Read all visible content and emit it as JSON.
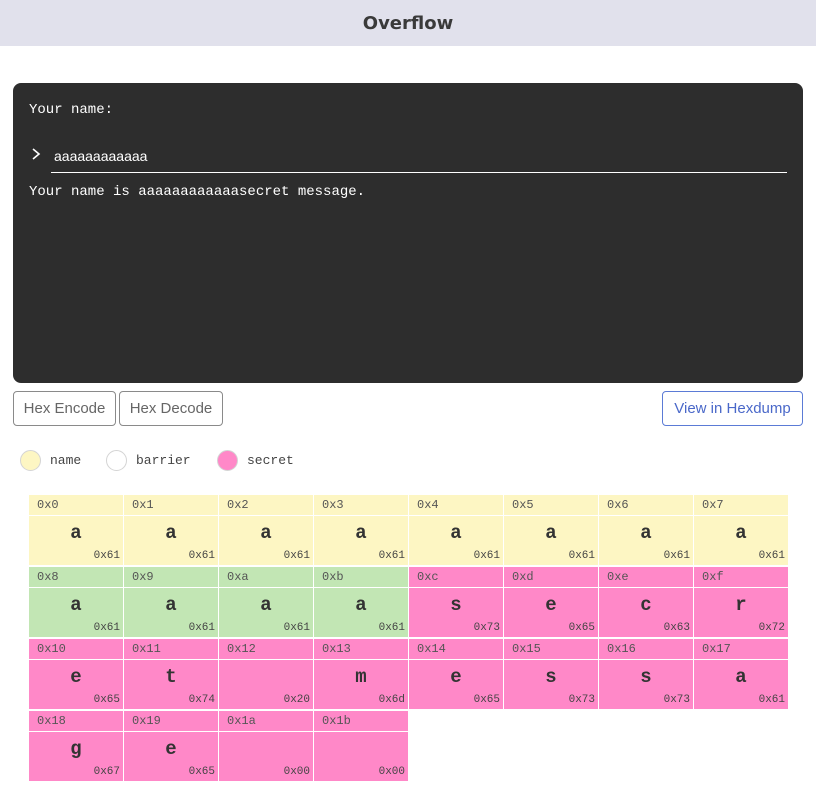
{
  "header": {
    "title": "Overflow"
  },
  "terminal": {
    "prompt": "Your name:",
    "input_value": "aaaaaaaaaaaa",
    "output": "Your name is aaaaaaaaaaaasecret message."
  },
  "buttons": {
    "hex_encode": "Hex Encode",
    "hex_decode": "Hex Decode",
    "view_hexdump": "View in Hexdump"
  },
  "legend": [
    {
      "label": "name",
      "color": "#fdf6c3"
    },
    {
      "label": "barrier",
      "color": "#ffffff"
    },
    {
      "label": "secret",
      "color": "#ff88c8"
    }
  ],
  "region_colors": {
    "name": "#fdf6c3",
    "barrier": "#c2e6b4",
    "secret": "#ff88c8"
  },
  "memory": [
    {
      "addr": "0x0",
      "char": "a",
      "hex": "0x61",
      "region": "name"
    },
    {
      "addr": "0x1",
      "char": "a",
      "hex": "0x61",
      "region": "name"
    },
    {
      "addr": "0x2",
      "char": "a",
      "hex": "0x61",
      "region": "name"
    },
    {
      "addr": "0x3",
      "char": "a",
      "hex": "0x61",
      "region": "name"
    },
    {
      "addr": "0x4",
      "char": "a",
      "hex": "0x61",
      "region": "name"
    },
    {
      "addr": "0x5",
      "char": "a",
      "hex": "0x61",
      "region": "name"
    },
    {
      "addr": "0x6",
      "char": "a",
      "hex": "0x61",
      "region": "name"
    },
    {
      "addr": "0x7",
      "char": "a",
      "hex": "0x61",
      "region": "name"
    },
    {
      "addr": "0x8",
      "char": "a",
      "hex": "0x61",
      "region": "barrier"
    },
    {
      "addr": "0x9",
      "char": "a",
      "hex": "0x61",
      "region": "barrier"
    },
    {
      "addr": "0xa",
      "char": "a",
      "hex": "0x61",
      "region": "barrier"
    },
    {
      "addr": "0xb",
      "char": "a",
      "hex": "0x61",
      "region": "barrier"
    },
    {
      "addr": "0xc",
      "char": "s",
      "hex": "0x73",
      "region": "secret"
    },
    {
      "addr": "0xd",
      "char": "e",
      "hex": "0x65",
      "region": "secret"
    },
    {
      "addr": "0xe",
      "char": "c",
      "hex": "0x63",
      "region": "secret"
    },
    {
      "addr": "0xf",
      "char": "r",
      "hex": "0x72",
      "region": "secret"
    },
    {
      "addr": "0x10",
      "char": "e",
      "hex": "0x65",
      "region": "secret"
    },
    {
      "addr": "0x11",
      "char": "t",
      "hex": "0x74",
      "region": "secret"
    },
    {
      "addr": "0x12",
      "char": "",
      "hex": "0x20",
      "region": "secret"
    },
    {
      "addr": "0x13",
      "char": "m",
      "hex": "0x6d",
      "region": "secret"
    },
    {
      "addr": "0x14",
      "char": "e",
      "hex": "0x65",
      "region": "secret"
    },
    {
      "addr": "0x15",
      "char": "s",
      "hex": "0x73",
      "region": "secret"
    },
    {
      "addr": "0x16",
      "char": "s",
      "hex": "0x73",
      "region": "secret"
    },
    {
      "addr": "0x17",
      "char": "a",
      "hex": "0x61",
      "region": "secret"
    },
    {
      "addr": "0x18",
      "char": "g",
      "hex": "0x67",
      "region": "secret"
    },
    {
      "addr": "0x19",
      "char": "e",
      "hex": "0x65",
      "region": "secret"
    },
    {
      "addr": "0x1a",
      "char": "",
      "hex": "0x00",
      "region": "secret"
    },
    {
      "addr": "0x1b",
      "char": "",
      "hex": "0x00",
      "region": "secret"
    }
  ]
}
